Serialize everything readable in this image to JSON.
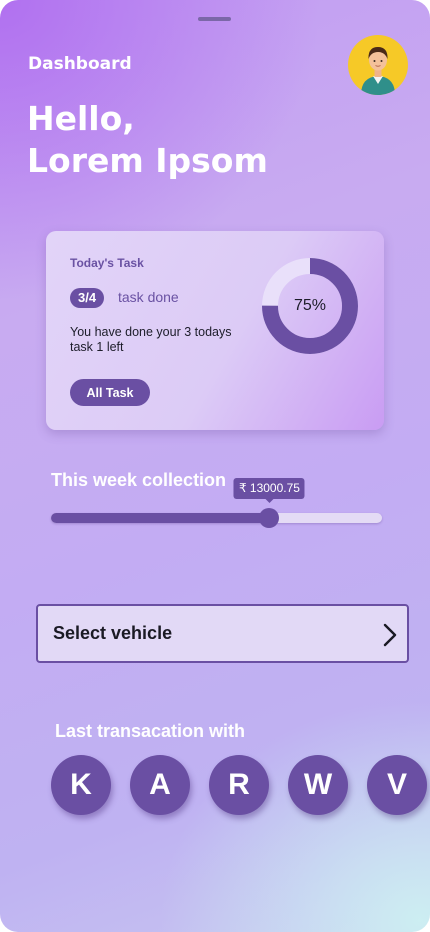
{
  "header": {
    "title": "Dashboard",
    "greeting_line1": "Hello,",
    "greeting_line2": "Lorem Ipsom"
  },
  "task_card": {
    "title": "Today's Task",
    "count": "3/4",
    "done_label": "task done",
    "description": "You have done your 3 todays task 1 left",
    "button_label": "All Task",
    "progress_text": "75%",
    "progress": 0.75
  },
  "collection": {
    "title": "This week collection",
    "value_label": "₹ 13000.75",
    "slider_fraction": 0.66
  },
  "vehicle": {
    "label": "Select vehicle",
    "icon": "chevron-right-icon"
  },
  "transactions": {
    "title": "Last transacation with",
    "contacts": [
      "K",
      "A",
      "R",
      "W",
      "V"
    ]
  },
  "colors": {
    "accent": "#6a4fa3",
    "avatar_bg": "#f6c927",
    "track": "#e4dbf5"
  }
}
